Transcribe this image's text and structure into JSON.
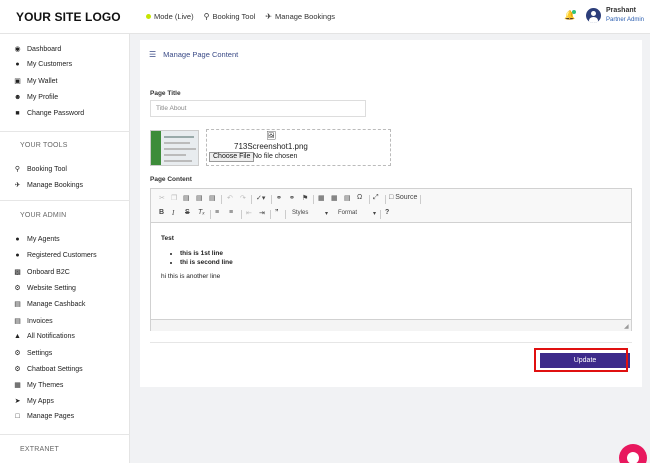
{
  "topbar": {
    "logo": "YOUR SITE LOGO",
    "nav": [
      {
        "label": "Mode (Live)",
        "icon": "live-dot"
      },
      {
        "label": "Booking Tool",
        "icon": "search-icon"
      },
      {
        "label": "Manage Bookings",
        "icon": "plane-icon"
      }
    ],
    "user": {
      "name": "Prashant",
      "role": "Partner Admin"
    },
    "colors": {
      "live": "#c6e500",
      "notification": "#2ec27e"
    }
  },
  "sidebar": {
    "main": [
      {
        "label": "Dashboard",
        "icon": "dashboard-icon"
      },
      {
        "label": "My Customers",
        "icon": "users-icon"
      },
      {
        "label": "My Wallet",
        "icon": "wallet-icon"
      },
      {
        "label": "My Profile",
        "icon": "user-icon"
      },
      {
        "label": "Change Password",
        "icon": "lock-icon"
      }
    ],
    "tools_heading": "YOUR TOOLS",
    "tools": [
      {
        "label": "Booking Tool",
        "icon": "search-icon"
      },
      {
        "label": "Manage Bookings",
        "icon": "plane-icon"
      }
    ],
    "admin_heading": "YOUR ADMIN",
    "admin": [
      {
        "label": "My Agents",
        "icon": "users-icon"
      },
      {
        "label": "Registered Customers",
        "icon": "users-icon"
      },
      {
        "label": "Onboard B2C",
        "icon": "clipboard-icon"
      },
      {
        "label": "Website Setting",
        "icon": "cogs-icon"
      },
      {
        "label": "Manage Cashback",
        "icon": "money-icon"
      },
      {
        "label": "Invoices",
        "icon": "invoice-icon"
      },
      {
        "label": "All Notifications",
        "icon": "bell-icon"
      },
      {
        "label": "Settings",
        "icon": "gear-icon"
      },
      {
        "label": "Chatboat Settings",
        "icon": "gear-icon"
      },
      {
        "label": "My Themes",
        "icon": "image-icon"
      },
      {
        "label": "My Apps",
        "icon": "send-icon"
      },
      {
        "label": "Manage Pages",
        "icon": "file-icon"
      }
    ],
    "extranet_heading": "EXTRANET"
  },
  "page": {
    "title": "Manage Page Content",
    "page_title_label": "Page Title",
    "page_title_placeholder": "Title About",
    "file_name": "713Screenshot1.png",
    "choose_file": "Choose File",
    "no_file": "No file chosen",
    "page_content_label": "Page Content",
    "update_label": "Update"
  },
  "editor": {
    "source_label": "Source",
    "styles_label": "Styles",
    "format_label": "Format",
    "content": {
      "heading": "Test",
      "bullets": [
        "this is 1st line",
        "thi is second line"
      ],
      "paragraph": "hi this is another line"
    }
  },
  "colors": {
    "accent": "#3d2a8a",
    "highlight": "#e01010",
    "chat": "#e8185e",
    "link": "#2c5fb1"
  }
}
